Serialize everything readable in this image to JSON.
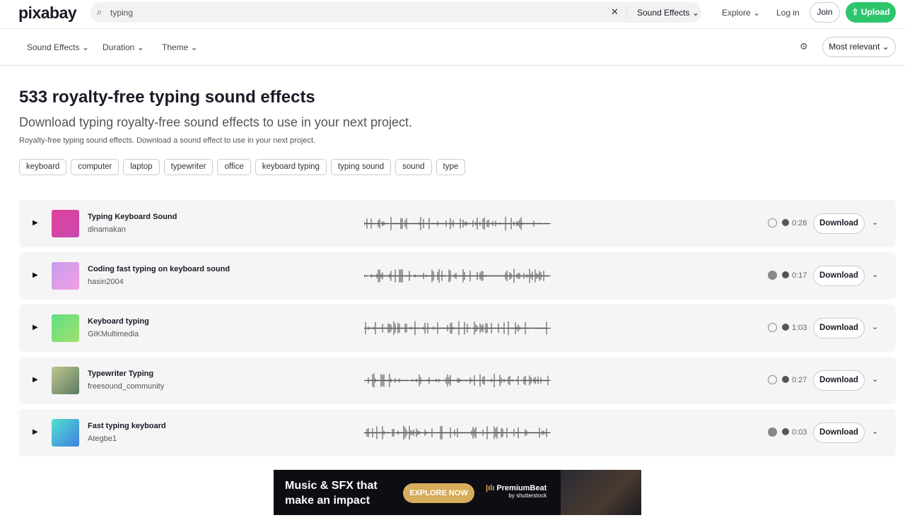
{
  "header": {
    "logo": "pixabay",
    "search_value": "typing",
    "search_category": "Sound Effects ⌄",
    "explore": "Explore ⌄",
    "login": "Log in",
    "join": "Join",
    "upload": "⇧ Upload"
  },
  "filters": {
    "items": [
      "Sound Effects ⌄",
      "Duration ⌄",
      "Theme ⌄"
    ],
    "sort": "Most relevant ⌄"
  },
  "page": {
    "title": "533 royalty-free typing sound effects",
    "subtitle": "Download typing royalty-free sound effects to use in your next project.",
    "description": "Royalty-free typing sound effects. Download a sound effect to use in your next project."
  },
  "tags": [
    "keyboard",
    "computer",
    "laptop",
    "typewriter",
    "office",
    "keyboard typing",
    "typing sound",
    "sound",
    "type"
  ],
  "tracks": [
    {
      "title": "Typing Keyboard Sound",
      "author": "dinamakan",
      "duration": "0:28",
      "download": "Download",
      "thumb": [
        "#e0409a",
        "#c84ab0"
      ],
      "badge": "verified"
    },
    {
      "title": "Coding fast typing on keyboard sound",
      "author": "hasin2004",
      "duration": "0:17",
      "download": "Download",
      "thumb": [
        "#c89cf0",
        "#f0a0e0"
      ],
      "badge": "star"
    },
    {
      "title": "Keyboard typing",
      "author": "GIKMultimedia",
      "duration": "1:03",
      "download": "Download",
      "thumb": [
        "#60e080",
        "#a0e070"
      ],
      "badge": "verified"
    },
    {
      "title": "Typewriter Typing",
      "author": "freesound_community",
      "duration": "0:27",
      "download": "Download",
      "thumb": [
        "#c0c890",
        "#5a7a60"
      ],
      "badge": "verified"
    },
    {
      "title": "Fast typing keyboard",
      "author": "Ategbe1",
      "duration": "0:03",
      "download": "Download",
      "thumb": [
        "#50e0d0",
        "#4080e0"
      ],
      "badge": "star"
    }
  ],
  "banner": {
    "headline_1": "Music & SFX that",
    "headline_2": "make an impact",
    "cta": "EXPLORE NOW",
    "brand": "PremiumBeat",
    "brand_sub": "by shutterstock"
  },
  "colors": {
    "accent": "#2ec66d",
    "banner_cta": "#d6ad5a"
  }
}
